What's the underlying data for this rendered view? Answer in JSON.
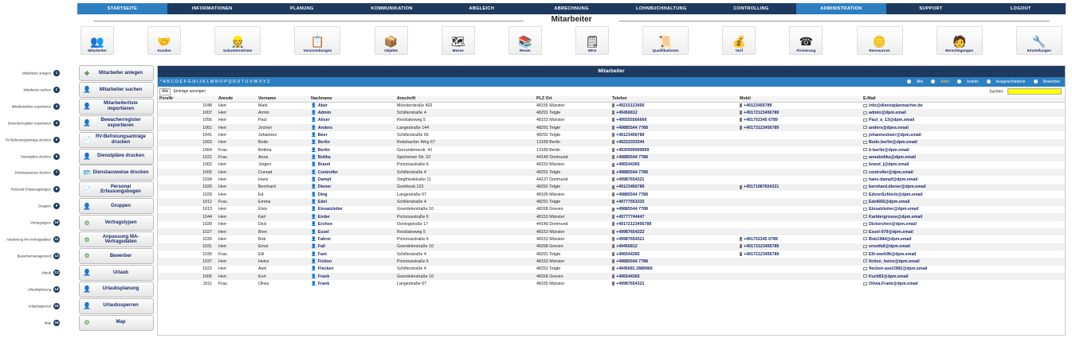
{
  "nav": [
    "STARTSEITE",
    "INFORMATIONEN",
    "PLANUNG",
    "KOMMUNIKATION",
    "ABGLEICH",
    "ABRECHNUNG",
    "LOHNBUCHHALTUNG",
    "CONTROLLING",
    "ADMINISTRATION",
    "SUPPORT",
    "LOGOUT"
  ],
  "heading": "Mitarbeiter",
  "icons": [
    {
      "label": "Mitarbeiter",
      "glyph": "👥"
    },
    {
      "label": "Kunden",
      "glyph": "🤝"
    },
    {
      "label": "Subunternehmer",
      "glyph": "👷"
    },
    {
      "label": "Veranstaltungen",
      "glyph": "📋"
    },
    {
      "label": "Objekte",
      "glyph": "📦"
    },
    {
      "label": "Messe",
      "glyph": "🗺"
    },
    {
      "label": "Revier",
      "glyph": "📚"
    },
    {
      "label": "WKS",
      "glyph": "🗒"
    },
    {
      "label": "Qualifikationen",
      "glyph": "📜"
    },
    {
      "label": "Tarif",
      "glyph": "💰"
    },
    {
      "label": "Firmierung",
      "glyph": "☎"
    },
    {
      "label": "Ressourcen",
      "glyph": "🪙"
    },
    {
      "label": "Berechtigungen",
      "glyph": "🧑"
    },
    {
      "label": "Einstellungen",
      "glyph": "🔧"
    }
  ],
  "side": [
    {
      "num": "1",
      "desc": "Mitarbeiter anlegen",
      "btn": "Mitarbeiter anlegen"
    },
    {
      "num": "2",
      "desc": "Mitarbeiter suchen",
      "btn": "Mitarbeiter suchen"
    },
    {
      "num": "3",
      "desc": "Mitarbeiterliste exportieren",
      "btn": "Mitarbeiterliste importieren"
    },
    {
      "num": "4",
      "desc": "Bewerberregister exportieren",
      "btn": "Bewacherregister exportieren"
    },
    {
      "num": "5",
      "desc": "RV-Befreiungsanträge drucken",
      "btn": "RV-Befreiungsanträge drucken"
    },
    {
      "num": "6",
      "desc": "Dienstpläne drucken",
      "btn": "Dienstpläne drucken"
    },
    {
      "num": "7",
      "desc": "Dienstausweise drucken",
      "btn": "Dienstausweise drucken"
    },
    {
      "num": "8",
      "desc": "Personal Erfassungsbogen",
      "btn": "Personal Erfassungsbogen"
    },
    {
      "num": "9",
      "desc": "Gruppen",
      "btn": "Gruppen"
    },
    {
      "num": "10",
      "desc": "Vertragstypen",
      "btn": "Vertragstypen"
    },
    {
      "num": "11",
      "desc": "Anpassung MA-Vertragsdaten",
      "btn": "Anpassung MA-Vertragsdaten"
    },
    {
      "num": "12",
      "desc": "Bewerbermanagement",
      "btn": "Bewerber"
    },
    {
      "num": "13",
      "desc": "Urlaub",
      "btn": "Urlaub"
    },
    {
      "num": "14",
      "desc": "Urlaubsplanung",
      "btn": "Urlaubsplanung"
    },
    {
      "num": "15",
      "desc": "Urlaubssperren",
      "btn": "Urlaubssperren"
    },
    {
      "num": "16",
      "desc": "Map",
      "btn": "Map"
    }
  ],
  "table": {
    "title": "Mitarbeiter",
    "alphabet": "* A B C D E F G H I J K L M N O P Q R S T U V W X Y Z",
    "filters": [
      "Alle",
      "Aktiv",
      "Inaktiv",
      "Ausgeschiedene",
      "Bewerber"
    ],
    "active_filter": "Aktiv",
    "show_select": "Alle",
    "show_label": "Einträge anzeigen",
    "search_label": "Suchen:",
    "headers": [
      "PersNr",
      "Anrede",
      "Vorname",
      "Nachname",
      "Anschrift",
      "PLZ Ort",
      "Telefon",
      "Mobil",
      "E-Mail"
    ],
    "rows": [
      [
        "1048",
        "Herr",
        "Mark",
        "Aber",
        "Münsterstraße 402",
        "48155 Münster",
        "+49215123456",
        "+49123456789",
        "info@dienstplanmacher.de"
      ],
      [
        "1007",
        "Herr",
        "Armin",
        "Admin",
        "Schillerstraße 4",
        "48291 Telgte",
        "+49456812",
        "+49172123456789",
        "admin@dpm.email"
      ],
      [
        "1056",
        "Herr",
        "Paul",
        "Aliser",
        "Recklakeweg 5",
        "48153 Münster",
        "+495555566666",
        "+491702345 6789",
        "Paul_a_13@dpm.email"
      ],
      [
        "1061",
        "Herr",
        "Jochen",
        "Anders",
        "Langestraße 144",
        "48291 Telgte",
        "+49885544 7788",
        "+49173123456789",
        "anders@dpes.email"
      ],
      [
        "1041",
        "Herr",
        "Johannes",
        "Beer",
        "Schillerstraße 66",
        "48291 Telgte",
        "+49123456789",
        "",
        "johannesbeer@dpm.email"
      ],
      [
        "1063",
        "Herr",
        "Bodo",
        "Berlin",
        "Reitzbacher Weg 67",
        "13189 Berlin",
        "+49222333344",
        "",
        "Bodo.berlin@dpm.email"
      ],
      [
        "1064",
        "Frau",
        "Bettina",
        "Berlin",
        "Gerrundenerstr. 41",
        "13189 Berlin",
        "+4930999999999",
        "",
        "b-berlin@dpm.email"
      ],
      [
        "1021",
        "Frau",
        "Anna",
        "Bolika",
        "Spichemer Str. 23",
        "44149 Dortmund",
        "+49885544 7788",
        "",
        "annabolika@dpm.email"
      ],
      [
        "1062",
        "Herr",
        "Jürgen",
        "Brand",
        "Pictoriusstraße 6",
        "48153 Münster",
        "+496544365",
        "",
        "brand_j@dpm.email"
      ],
      [
        "1005",
        "Herr",
        "Conrad",
        "Controller",
        "Schillerstraße 4",
        "48291 Telgte",
        "+49885544 7788",
        "",
        "controller@dpm.email"
      ],
      [
        "1034",
        "Herr",
        "Hans",
        "Dampf",
        "Siegfriedstraße 11",
        "44137 Dortmund",
        "+49987654321",
        "",
        "hans-dampf@dpm.email"
      ],
      [
        "1025",
        "Herr",
        "Bernhard",
        "Diener",
        "Goethestr.123",
        "48291 Telgte",
        "+49123456789",
        "+49171987654321",
        "bernhard.diener@dpm.email"
      ],
      [
        "1029",
        "Herr",
        "Ed",
        "Ding",
        "Langestraße 67",
        "48165 Münster",
        "+49885544 7788",
        "",
        "EdvonSchleck@dpm.email"
      ],
      [
        "1012",
        "Frau",
        "Emma",
        "Edel",
        "Schillerstraße 4",
        "48291 Telgte",
        "+49777553333",
        "",
        "Edel666@dpm.email"
      ],
      [
        "1013",
        "Herr",
        "Elvis",
        "Einsatzleiter",
        "Goerdelerstraße 10",
        "48268 Greven",
        "+49885544 7788",
        "",
        "Einsatzleiter@dpm.email"
      ],
      [
        "1044",
        "Herr",
        "Karl",
        "Ender",
        "Pictoriusstraße 6",
        "48153 Münster",
        "+49777744447",
        "",
        "Karldergrosse@dpm.email"
      ],
      [
        "1028",
        "Herr",
        "Dick",
        "Erchen",
        "Osningstraße 17",
        "44149 Dortmund",
        "+49172123456789",
        "",
        "Dickerchen@dpm.email"
      ],
      [
        "1027",
        "Herr",
        "Bren",
        "Essel",
        "Recklakeweg 5",
        "48153 Münster",
        "+49987654322",
        "",
        "Essel-079@dpm.email"
      ],
      [
        "1026",
        "Herr",
        "Bob",
        "Fahrer",
        "Pictoriusstraße 6",
        "48153 Münster",
        "+49987654321",
        "+491702345 6789",
        "Bob1984@dpm.email"
      ],
      [
        "1031",
        "Herr",
        "Ernst",
        "Fall",
        "Goerdelerstraße 10",
        "48268 Greven",
        "+49456812",
        "+49173123456789",
        "ernstfall@dpm.email"
      ],
      [
        "1030",
        "Frau",
        "Elli",
        "Fant",
        "Schillerstraße 4",
        "48291 Telgte",
        "+496544365",
        "+49172123456789",
        "Elli-work96@dpm.email"
      ],
      [
        "1037",
        "Herr",
        "Heinz",
        "Fiction",
        "Pictoriusstraße 6",
        "48153 Münster",
        "+49885544 7788",
        "",
        "fiction_heinz@dpm.email"
      ],
      [
        "1023",
        "Herr",
        "Axel",
        "Flecken",
        "Schillerstraße 4",
        "48291 Telgte",
        "+4945681 2889966",
        "",
        "flecken-axel1982@dpm.email"
      ],
      [
        "1006",
        "Herr",
        "Kurt",
        "Frank",
        "Goerdelerstraße 10",
        "48268 Greven",
        "+496544365",
        "",
        "Kurti83@dpm.email"
      ],
      [
        "1011",
        "Frau",
        "Olivia",
        "Frank",
        "Langestraße 67",
        "48165 Münster",
        "+49987654321",
        "",
        "Olivia.Frank@dpm.email"
      ]
    ]
  }
}
